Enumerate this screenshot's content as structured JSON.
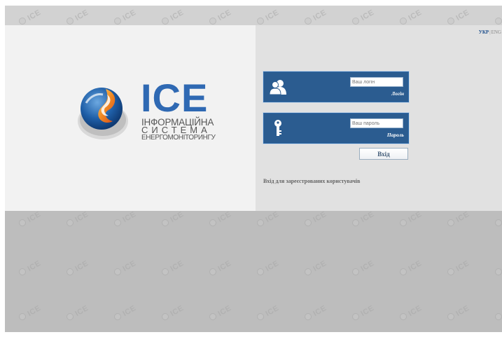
{
  "language": {
    "active": "УКР",
    "separator": "|",
    "other": "ENG"
  },
  "logo": {
    "title": "ICE",
    "line1": "ІНФОРМАЦІЙНА",
    "line2": "СИСТЕМА",
    "line3": "ЕНЕРГОМОНІТОРИНГУ"
  },
  "form": {
    "login": {
      "placeholder": "Ваш логін",
      "label": "Логін",
      "icon": "users-icon"
    },
    "password": {
      "placeholder": "Ваш пароль",
      "label": "Пароль",
      "icon": "key-icon"
    },
    "submit_label": "Вхід",
    "registered_link": "Вхід для зареєстрованих користувачів"
  },
  "watermark_text": "ICE",
  "colors": {
    "brand_blue": "#2f69b3",
    "field_box": "#2b5c90",
    "left_panel": "#f2f2f2",
    "right_panel": "#e1e1e1",
    "background": "#c4c4c4"
  }
}
